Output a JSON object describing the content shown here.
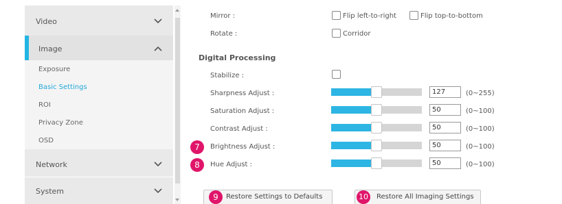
{
  "sidebar": {
    "sections": [
      {
        "label": "Video",
        "expanded": false
      },
      {
        "label": "Image",
        "expanded": true
      },
      {
        "label": "Network",
        "expanded": false
      },
      {
        "label": "System",
        "expanded": false
      }
    ],
    "image_items": [
      "Exposure",
      "Basic Settings",
      "ROI",
      "Privacy Zone",
      "OSD"
    ],
    "selected_item": "Basic Settings",
    "accent_color": "#23b5e2"
  },
  "mirror": {
    "label": "Mirror :",
    "options": [
      {
        "label": "Flip left-to-right",
        "checked": false
      },
      {
        "label": "Flip top-to-bottom",
        "checked": false
      }
    ]
  },
  "rotate": {
    "label": "Rotate :",
    "option": {
      "label": "Corridor",
      "checked": false
    }
  },
  "digital_processing": {
    "title": "Digital Processing",
    "stabilize": {
      "label": "Stabilize :",
      "checked": false
    },
    "adjustments": [
      {
        "label": "Sharpness Adjust :",
        "value": "127",
        "range": "(0~255)",
        "level": 0.5
      },
      {
        "label": "Saturation Adjust :",
        "value": "50",
        "range": "(0~100)",
        "level": 0.5
      },
      {
        "label": "Contrast Adjust :",
        "value": "50",
        "range": "(0~100)",
        "level": 0.5
      },
      {
        "label": "Brightness Adjust :",
        "value": "50",
        "range": "(0~100)",
        "level": 0.5,
        "callout": "7"
      },
      {
        "label": "Hue Adjust :",
        "value": "50",
        "range": "(0~100)",
        "level": 0.5,
        "callout": "8"
      }
    ]
  },
  "buttons": {
    "restore_defaults": {
      "label": "Restore Settings to Defaults",
      "callout": "9"
    },
    "restore_all": {
      "label": "Restore All Imaging Settings",
      "callout": "10"
    }
  },
  "colors": {
    "slider_fill": "#2db5e3",
    "callout": "#e0156a"
  }
}
